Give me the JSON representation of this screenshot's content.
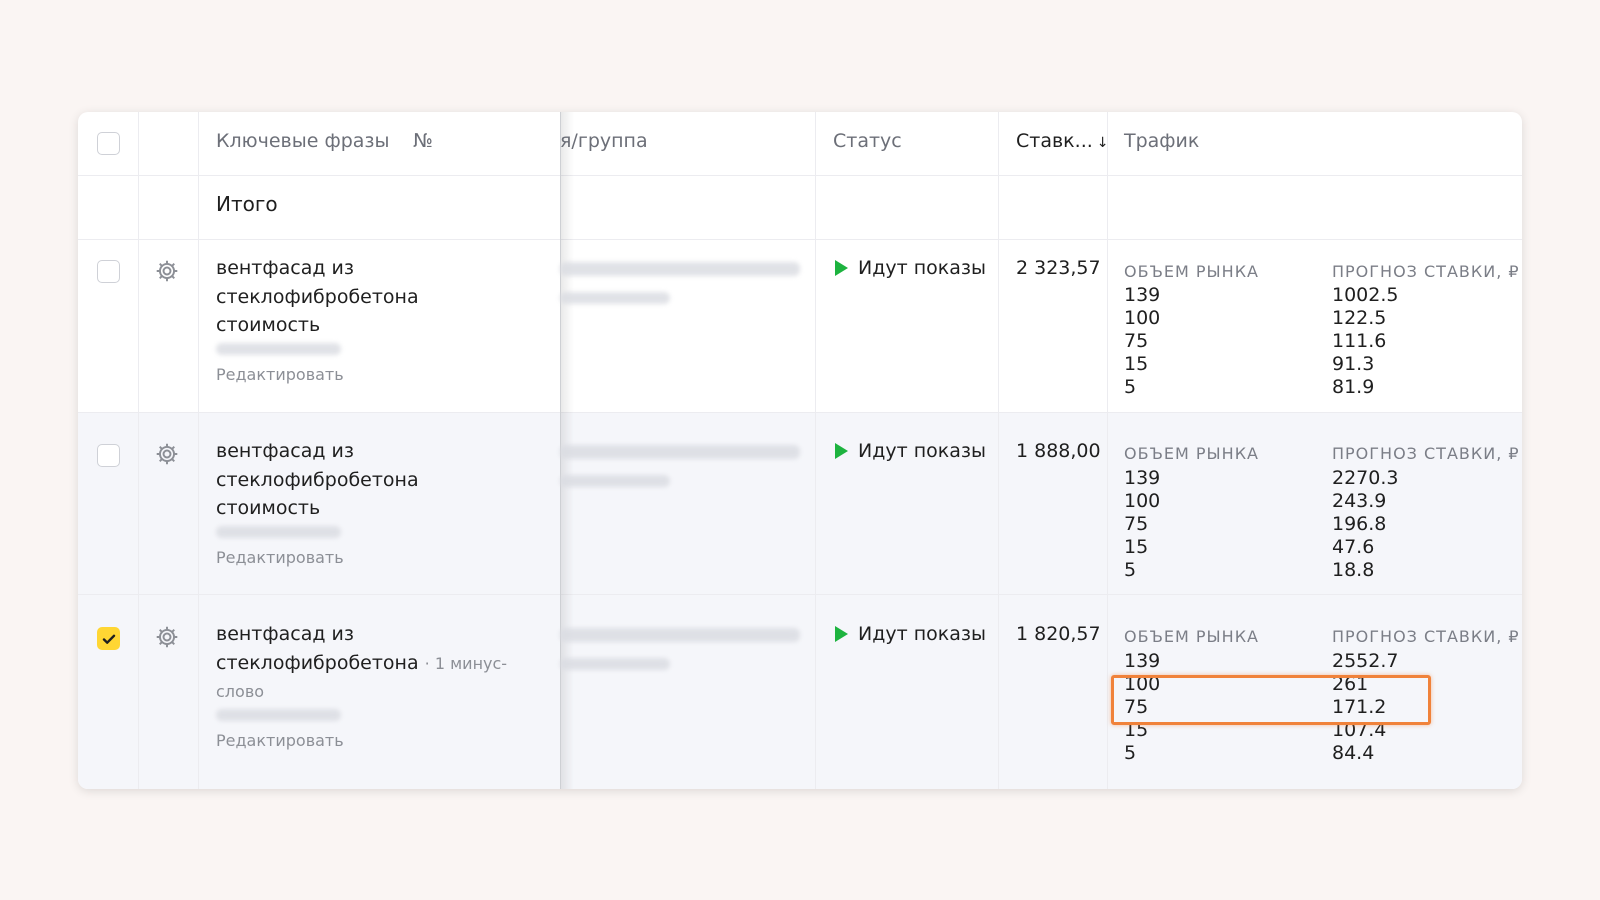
{
  "header": {
    "keywords_label": "Ключевые фразы",
    "number_label": "№",
    "group_label": "я/группа",
    "status_label": "Статус",
    "bid_label": "Ставк...",
    "bid_sort": "↓",
    "traffic_label": "Трафик"
  },
  "total_label": "Итого",
  "traffic_labels": {
    "market_volume": "ОБЪЕМ РЫНКА",
    "bid_forecast": "ПРОГНОЗ СТАВКИ, ₽"
  },
  "rows": [
    {
      "checked": false,
      "keyword_line1": "вентфасад из",
      "keyword_line2": "стеклофибробетона",
      "keyword_line3": "стоимость",
      "minus_words": "",
      "edit_label": "Редактировать",
      "status": "Идут показы",
      "bid": "2 323,57",
      "volume": [
        "139",
        "100",
        "75",
        "15",
        "5"
      ],
      "forecast": [
        "1002.5",
        "122.5",
        "111.6",
        "91.3",
        "81.9"
      ]
    },
    {
      "checked": false,
      "keyword_line1": "вентфасад из",
      "keyword_line2": "стеклофибробетона",
      "keyword_line3": "стоимость",
      "minus_words": "",
      "edit_label": "Редактировать",
      "status": "Идут показы",
      "bid": "1 888,00",
      "volume": [
        "139",
        "100",
        "75",
        "15",
        "5"
      ],
      "forecast": [
        "2270.3",
        "243.9",
        "196.8",
        "47.6",
        "18.8"
      ]
    },
    {
      "checked": true,
      "keyword_line1": "вентфасад из",
      "keyword_line2": "стеклофибробетона",
      "keyword_line3": "слово",
      "minus_words": "· 1 минус-",
      "edit_label": "Редактировать",
      "status": "Идут показы",
      "bid": "1 820,57",
      "volume": [
        "139",
        "100",
        "75",
        "15",
        "5"
      ],
      "forecast": [
        "2552.7",
        "261",
        "171.2",
        "107.4",
        "84.4"
      ]
    }
  ],
  "colors": {
    "accent_checkbox": "#ffd633",
    "status_play": "#1db33f",
    "highlight": "#f0823a"
  }
}
